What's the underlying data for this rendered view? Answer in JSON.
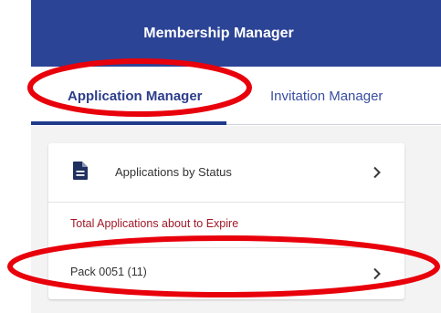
{
  "header": {
    "title": "Membership Manager",
    "bg_color": "#2c4496"
  },
  "tabs": [
    {
      "label": "Application Manager",
      "active": true
    },
    {
      "label": "Invitation Manager",
      "active": false
    }
  ],
  "card": {
    "status_row": {
      "label": "Applications by Status",
      "icon": "document-icon"
    },
    "expire_section_label": "Total Applications about to Expire",
    "pack_row": {
      "label": "Pack 0051 (11)"
    }
  },
  "colors": {
    "accent": "#1e3a8a",
    "warning_text": "#a01828",
    "annotation": "#e8000b"
  },
  "annotations": [
    "red-ellipse-around-application-manager-tab",
    "red-ellipse-around-pack-row"
  ]
}
